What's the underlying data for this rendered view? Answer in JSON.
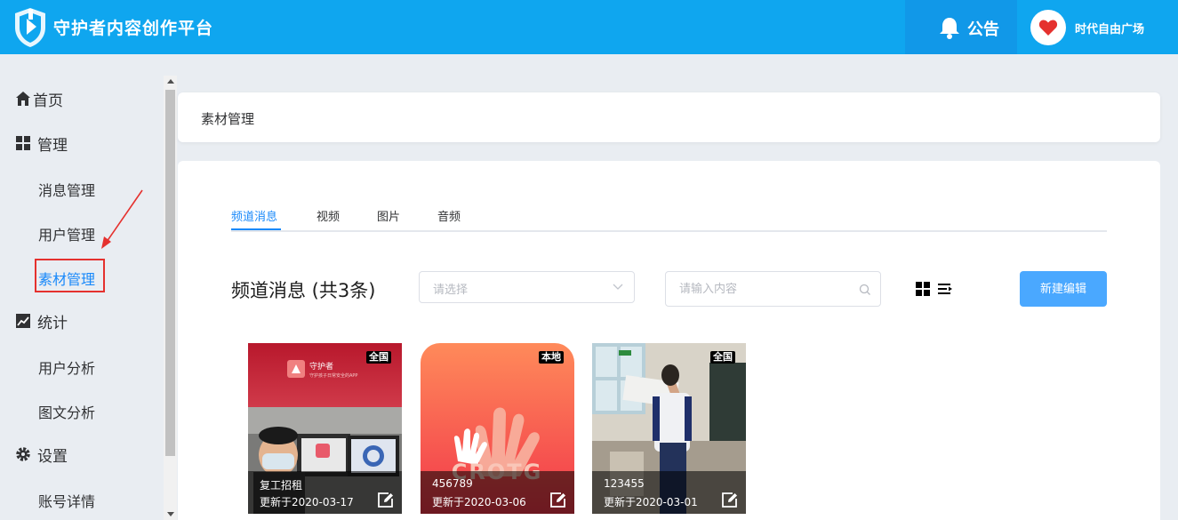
{
  "header": {
    "app_title": "守护者内容创作平台",
    "notice_label": "公告",
    "username": "时代自由广场",
    "brand_color": "#0fa6ef"
  },
  "sidebar": {
    "home": {
      "label": "首页",
      "icon": "home-icon"
    },
    "manage": {
      "label": "管理",
      "icon": "grid-icon"
    },
    "manage_items": [
      "消息管理",
      "用户管理",
      "素材管理"
    ],
    "stats": {
      "label": "统计",
      "icon": "chart-icon"
    },
    "stats_items": [
      "用户分析",
      "图文分析"
    ],
    "settings": {
      "label": "设置",
      "icon": "gear-icon"
    },
    "settings_items": [
      "账号详情"
    ],
    "active_item": "素材管理"
  },
  "breadcrumb": {
    "title": "素材管理"
  },
  "tabs": [
    "频道消息",
    "视频",
    "图片",
    "音频"
  ],
  "active_tab": "频道消息",
  "toolbar": {
    "section_title": "频道消息 (共3条)",
    "select_placeholder": "请选择",
    "search_placeholder": "请输入内容",
    "new_button": "新建编辑"
  },
  "media": [
    {
      "badge": "全国",
      "title": "复工招租",
      "date": "更新于2020-03-17"
    },
    {
      "badge": "本地",
      "title": "456789",
      "date": "更新于2020-03-06"
    },
    {
      "badge": "全国",
      "title": "123455",
      "date": "更新于2020-03-01"
    }
  ],
  "thumbnails": {
    "app_promo_name": "守护者",
    "app_promo_slogan": "守护孩子日常安全的APP",
    "logo_text": "CROTG"
  }
}
